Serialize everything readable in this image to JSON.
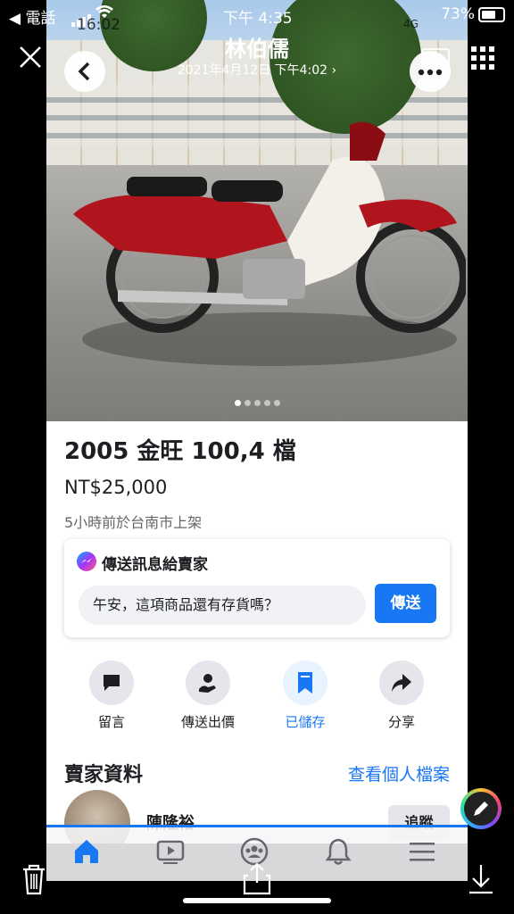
{
  "status_bar": {
    "carrier": "◀ 電話",
    "time": "下午 4:35",
    "photo_overlay_time": "16:02",
    "network": "4G",
    "battery": "73%"
  },
  "viewer_header": {
    "title": "林伯儒",
    "subtitle": "2021年4月12日 下午4:02 ›"
  },
  "image_pager": {
    "count": 5,
    "active": 0
  },
  "listing": {
    "title": "2005 金旺 100,4 檔",
    "price": "NT$25,000",
    "meta": "5小時前於台南市上架"
  },
  "message_card": {
    "heading": "傳送訊息給賣家",
    "input_text": "午安，這項商品還有存貨嗎？",
    "send_label": "傳送"
  },
  "actions": [
    {
      "label": "留言",
      "icon": "comment-icon"
    },
    {
      "label": "傳送出價",
      "icon": "offer-icon"
    },
    {
      "label": "已儲存",
      "icon": "bookmark-icon",
      "selected": true
    },
    {
      "label": "分享",
      "icon": "share-icon"
    }
  ],
  "seller": {
    "heading": "賣家資料",
    "profile_link": "查看個人檔案",
    "name": "陳隆裕",
    "follow_label": "追蹤"
  },
  "bottom_tabs": [
    "home-icon",
    "video-icon",
    "groups-icon",
    "notification-bell-icon",
    "menu-icon"
  ],
  "colors": {
    "accent": "#1877f2",
    "bg": "#000000"
  }
}
